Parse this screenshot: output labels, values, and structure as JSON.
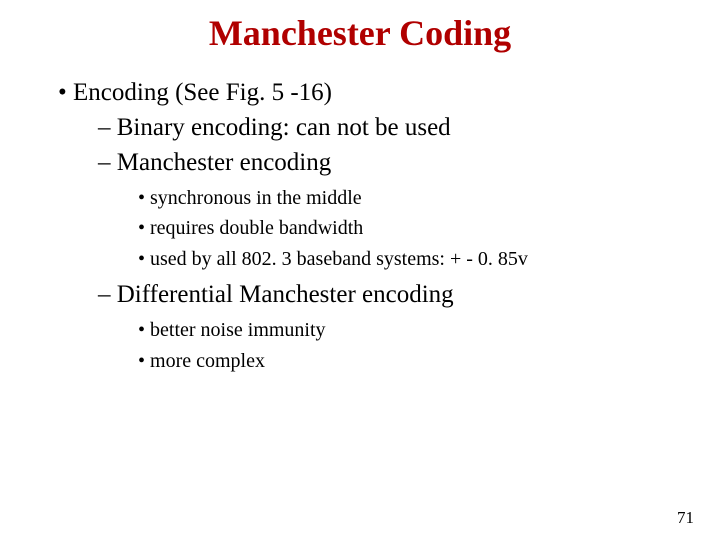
{
  "title": "Manchester Coding",
  "l1_1": "Encoding (See Fig. 5 -16)",
  "l2_1": "Binary encoding: can not be used",
  "l2_2": "Manchester encoding",
  "l3a_1": "synchronous in the middle",
  "l3a_2": "requires double bandwidth",
  "l3a_3": "used by all 802. 3 baseband systems: + - 0. 85v",
  "l2_3": "Differential Manchester encoding",
  "l3b_1": "better noise immunity",
  "l3b_2": "more complex",
  "page_number": "71"
}
